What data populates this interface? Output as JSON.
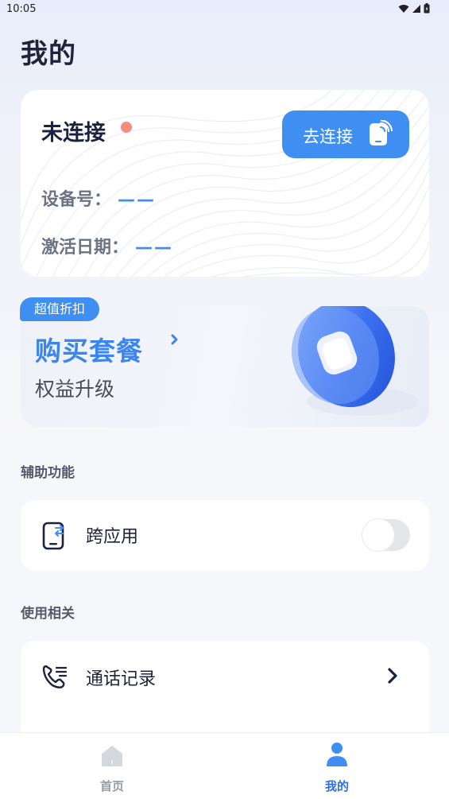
{
  "status_bar": {
    "time": "10:05"
  },
  "page": {
    "title": "我的"
  },
  "device": {
    "status": "未连接",
    "connect_button": "去连接",
    "device_no_label": "设备号：",
    "device_no_value": "——",
    "activation_label": "激活日期：",
    "activation_value": "——"
  },
  "promo": {
    "tag": "超值折扣",
    "title": "购买套餐",
    "subtitle": "权益升级"
  },
  "accessibility": {
    "section_title": "辅助功能",
    "cross_app_label": "跨应用",
    "cross_app_enabled": false
  },
  "usage": {
    "section_title": "使用相关",
    "call_log_label": "通话记录"
  },
  "bottom_nav": {
    "items": [
      {
        "label": "首页",
        "icon": "home-icon",
        "active": false
      },
      {
        "label": "我的",
        "icon": "user-icon",
        "active": true
      }
    ]
  },
  "colors": {
    "accent": "#3f8ff3",
    "status_dot": "#f38d82",
    "inactive_nav": "#9a9ca8"
  }
}
